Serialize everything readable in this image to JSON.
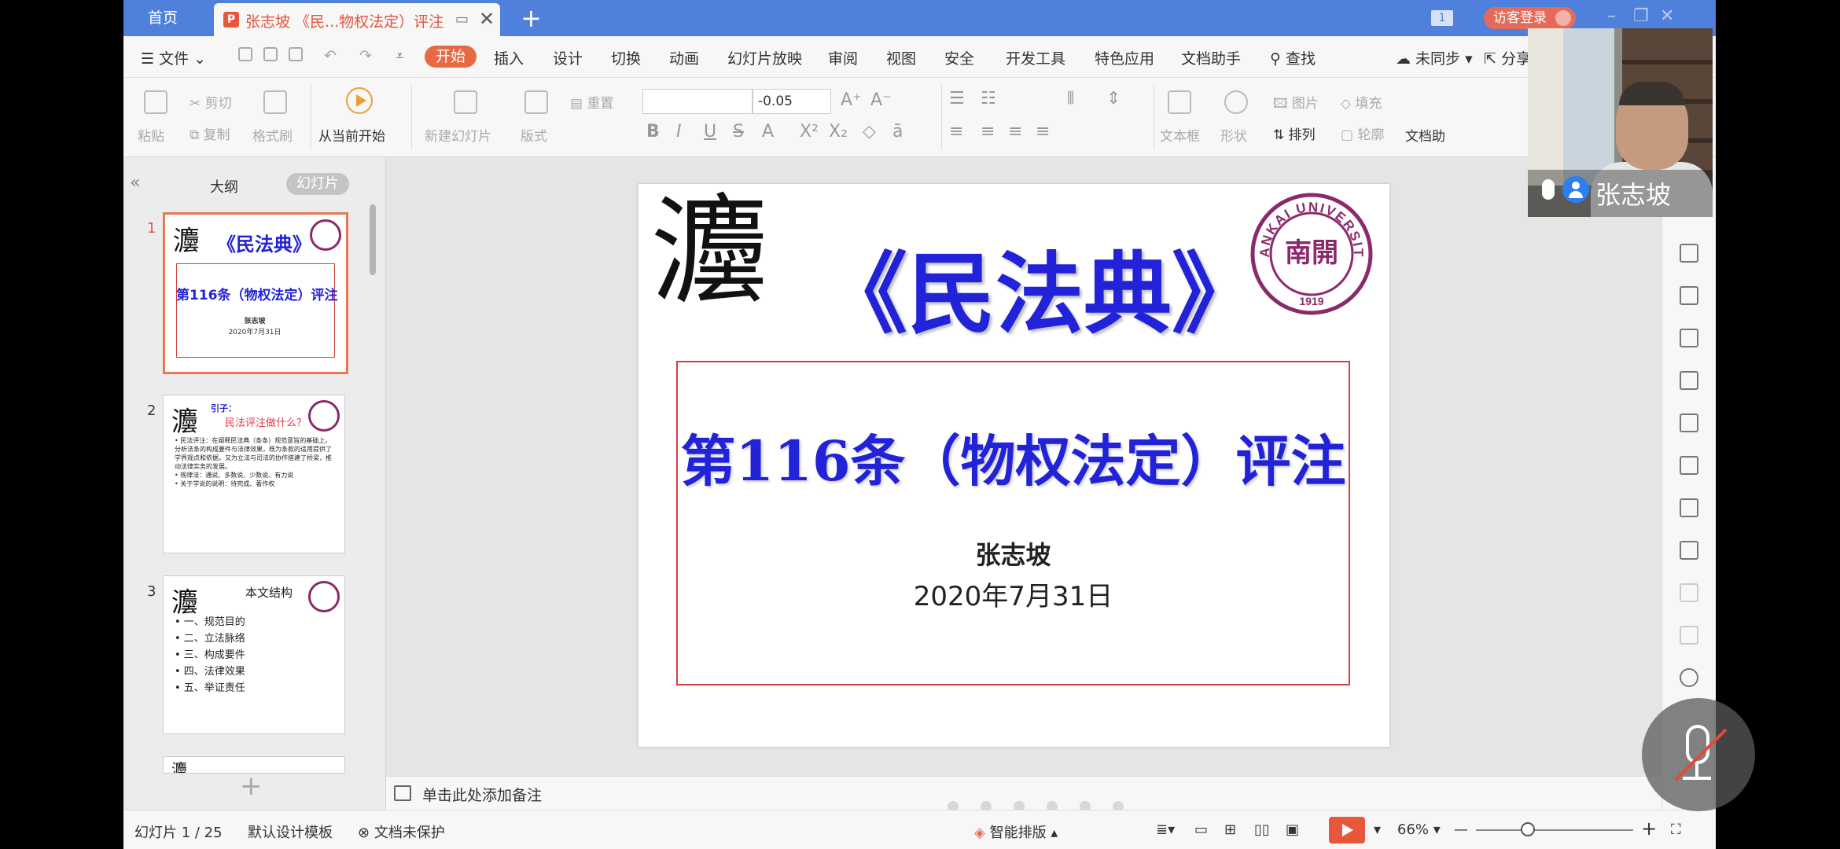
{
  "tabbar": {
    "home": "首页",
    "doc_tab": "张志坡 《民...物权法定）评注",
    "page_badge": "1",
    "visitor_login": "访客登录"
  },
  "menubar": {
    "file": "文件",
    "items": [
      "开始",
      "插入",
      "设计",
      "切换",
      "动画",
      "幻灯片放映",
      "审阅",
      "视图",
      "安全",
      "开发工具",
      "特色应用",
      "文档助手"
    ],
    "search": "查找",
    "unsync": "未同步",
    "share": "分享"
  },
  "ribbon": {
    "paste": "粘贴",
    "cut": "剪切",
    "copy": "复制",
    "format_painter": "格式刷",
    "from_current": "从当前开始",
    "new_slide": "新建幻灯片",
    "layout": "版式",
    "reset": "重置",
    "font_size": "-0.05",
    "text_box": "文本框",
    "shape": "形状",
    "arrange": "排列",
    "picture": "图片",
    "fill": "填充",
    "outline": "轮廓",
    "doc_helper": "文档助"
  },
  "left_panel": {
    "outline_tab": "大纲",
    "slides_tab": "幻灯片",
    "thumbs": [
      {
        "num": "1",
        "title": "《民法典》",
        "subtitle": "第116条（物权法定）评注",
        "author": "张志坡",
        "date": "2020年7月31日"
      },
      {
        "num": "2",
        "heading": "引子：",
        "title": "民法评注做什么？",
        "lines": [
          "• 民法评注：在阐释民法典（条条）规范意旨的基础上，分析法条的构成要件与法律效果，既为条款的适用提供了学界观点和依据，又为立法与司法的协作搭建了桥梁，推动法律实务的发展。",
          "• 规律法：通说、多数说、少数说、有力说",
          "• 关于学说的说明：待完成、著作权"
        ]
      },
      {
        "num": "3",
        "title": "本文结构",
        "lines": [
          "• 一、规范目的",
          "• 二、立法脉络",
          "• 三、构成要件",
          "• 四、法律效果",
          "• 五、举证责任"
        ]
      }
    ]
  },
  "slide": {
    "title": "《民法典》",
    "subtitle": "第116条（物权法定）评注",
    "author": "张志坡",
    "date": "2020年7月31日",
    "logo_text_top": "NANKAI UNIVERSITY",
    "logo_year": "1919",
    "logo_center": "南開"
  },
  "notes": {
    "placeholder": "单击此处添加备注"
  },
  "statusbar": {
    "slide_count": "幻灯片 1 / 25",
    "template": "默认设计模板",
    "unprotected": "文档未保护",
    "smart_layout": "智能排版",
    "zoom": "66%"
  },
  "video": {
    "name": "张志坡"
  },
  "colors": {
    "tab_bar": "#4f81dc",
    "accent_orange": "#e86a45",
    "slide_title_blue": "#2222d8",
    "frame_red": "#d04040",
    "logo_purple": "#8b2a6b"
  }
}
